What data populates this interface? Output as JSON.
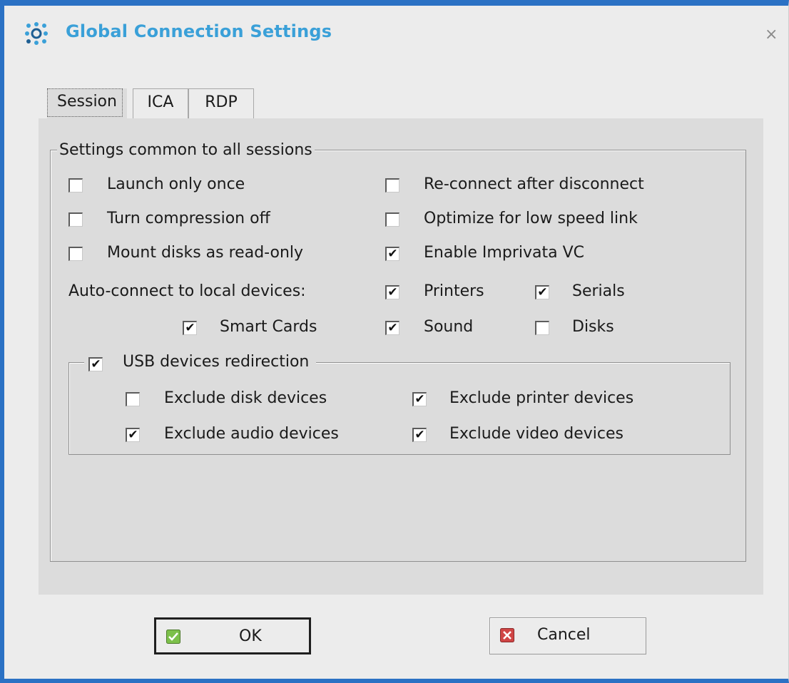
{
  "dialog": {
    "title": "Global Connection Settings",
    "close_glyph": "×",
    "title_icon": "settings-dots-icon",
    "accent": "#3aa0d8"
  },
  "tabs": [
    {
      "label": "Session",
      "active": true
    },
    {
      "label": "ICA",
      "active": false
    },
    {
      "label": "RDP",
      "active": false
    }
  ],
  "group": {
    "title": "Settings common to all sessions",
    "auto_connect_label": "Auto-connect to local devices:"
  },
  "options": {
    "launch_only_once": {
      "label": "Launch only once",
      "checked": false
    },
    "reconnect": {
      "label": "Re-connect after disconnect",
      "checked": false
    },
    "compression_off": {
      "label": "Turn compression off",
      "checked": false
    },
    "optimize_low_speed": {
      "label": "Optimize for low speed link",
      "checked": false
    },
    "mount_read_only": {
      "label": "Mount disks as read-only",
      "checked": false
    },
    "imprivata": {
      "label": "Enable Imprivata VC",
      "checked": true
    },
    "printers": {
      "label": "Printers",
      "checked": true
    },
    "serials": {
      "label": "Serials",
      "checked": true
    },
    "smart_cards": {
      "label": "Smart Cards",
      "checked": true
    },
    "sound": {
      "label": "Sound",
      "checked": true
    },
    "disks": {
      "label": "Disks",
      "checked": false
    }
  },
  "usb": {
    "label": "USB devices redirection",
    "checked": true,
    "exclude_disk": {
      "label": "Exclude disk devices",
      "checked": false
    },
    "exclude_printer": {
      "label": "Exclude printer devices",
      "checked": true
    },
    "exclude_audio": {
      "label": "Exclude audio devices",
      "checked": true
    },
    "exclude_video": {
      "label": "Exclude video devices",
      "checked": true
    }
  },
  "buttons": {
    "ok": {
      "label": "OK",
      "icon": "check-icon",
      "color": "#6fb83a"
    },
    "cancel": {
      "label": "Cancel",
      "icon": "cancel-icon",
      "color": "#cc3b3b"
    }
  }
}
